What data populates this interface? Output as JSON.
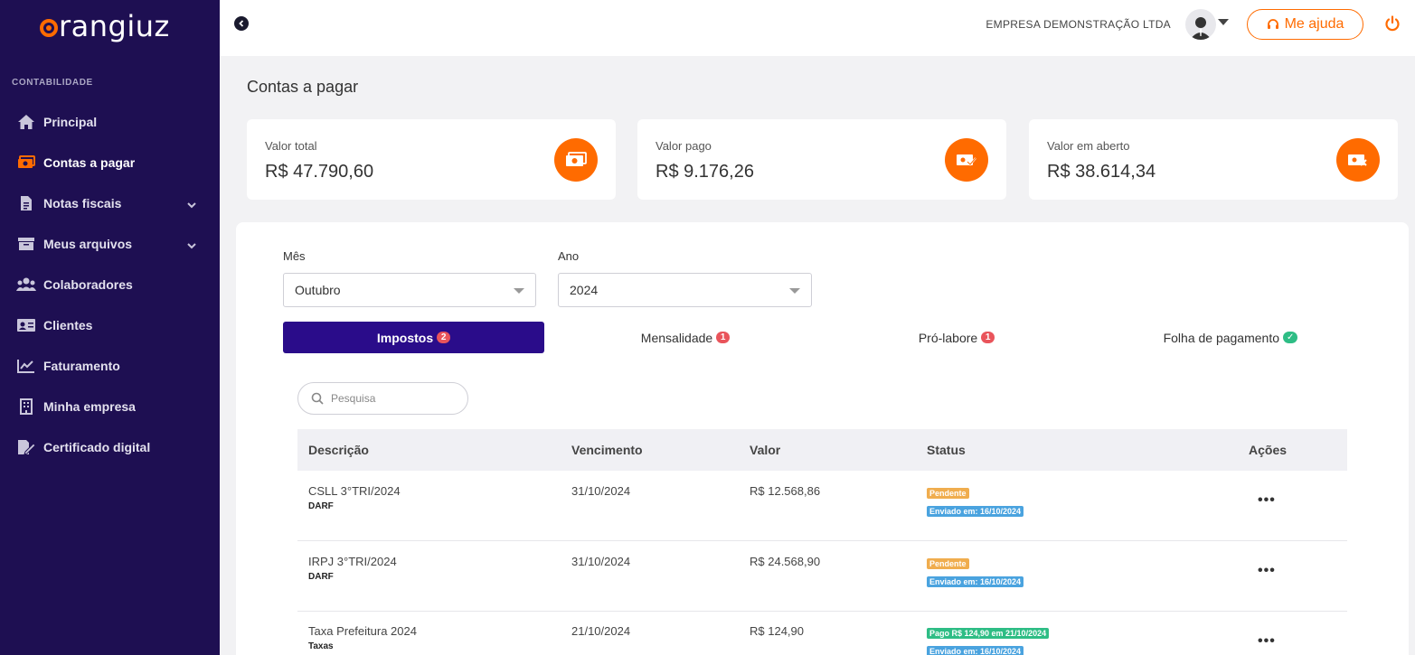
{
  "brand": {
    "name": "rangiuz"
  },
  "sidebar": {
    "section": "CONTABILIDADE",
    "items": [
      {
        "label": "Principal",
        "icon": "home-icon"
      },
      {
        "label": "Contas a pagar",
        "icon": "money-icon",
        "active": true
      },
      {
        "label": "Notas fiscais",
        "icon": "file-invoice-icon",
        "expandable": true
      },
      {
        "label": "Meus arquivos",
        "icon": "archive-icon",
        "expandable": true
      },
      {
        "label": "Colaboradores",
        "icon": "users-icon"
      },
      {
        "label": "Clientes",
        "icon": "id-card-icon"
      },
      {
        "label": "Faturamento",
        "icon": "chart-line-icon"
      },
      {
        "label": "Minha empresa",
        "icon": "building-icon"
      },
      {
        "label": "Certificado digital",
        "icon": "file-signature-icon"
      }
    ]
  },
  "topbar": {
    "company": "EMPRESA DEMONSTRAÇÃO LTDA",
    "help_label": "Me ajuda"
  },
  "page": {
    "title": "Contas a pagar"
  },
  "summary": [
    {
      "label": "Valor total",
      "value": "R$ 47.790,60",
      "icon": "money-bill-icon"
    },
    {
      "label": "Valor pago",
      "value": "R$ 9.176,26",
      "icon": "money-check-icon"
    },
    {
      "label": "Valor em aberto",
      "value": "R$ 38.614,34",
      "icon": "money-x-icon"
    }
  ],
  "filters": {
    "month_label": "Mês",
    "month_value": "Outubro",
    "year_label": "Ano",
    "year_value": "2024"
  },
  "tabs": [
    {
      "label": "Impostos",
      "count": "2",
      "active": true
    },
    {
      "label": "Mensalidade",
      "count": "1"
    },
    {
      "label": "Pró-labore",
      "count": "1"
    },
    {
      "label": "Folha de pagamento",
      "count": "✓"
    }
  ],
  "search": {
    "placeholder": "Pesquisa"
  },
  "table": {
    "headers": [
      "Descrição",
      "Vencimento",
      "Valor",
      "Status",
      "Ações"
    ],
    "rows": [
      {
        "desc": "CSLL 3°TRI/2024",
        "type": "DARF",
        "due": "31/10/2024",
        "value": "R$ 12.568,86",
        "status1": "Pendente",
        "status2": "Enviado em: 16/10/2024",
        "actions": "•••"
      },
      {
        "desc": "IRPJ 3°TRI/2024",
        "type": "DARF",
        "due": "31/10/2024",
        "value": "R$ 24.568,90",
        "status1": "Pendente",
        "status2": "Enviado em: 16/10/2024",
        "actions": "•••"
      },
      {
        "desc": "Taxa Prefeitura 2024",
        "type": "Taxas",
        "due": "21/10/2024",
        "value": "R$ 124,90",
        "status1": "Pago R$ 124,90 em 21/10/2024",
        "status2": "Enviado em: 16/10/2024",
        "actions": "•••"
      }
    ]
  },
  "colors": {
    "sidebar": "#1e0f52",
    "accent": "#ff6b00",
    "tab_active": "#2a0c8a"
  }
}
